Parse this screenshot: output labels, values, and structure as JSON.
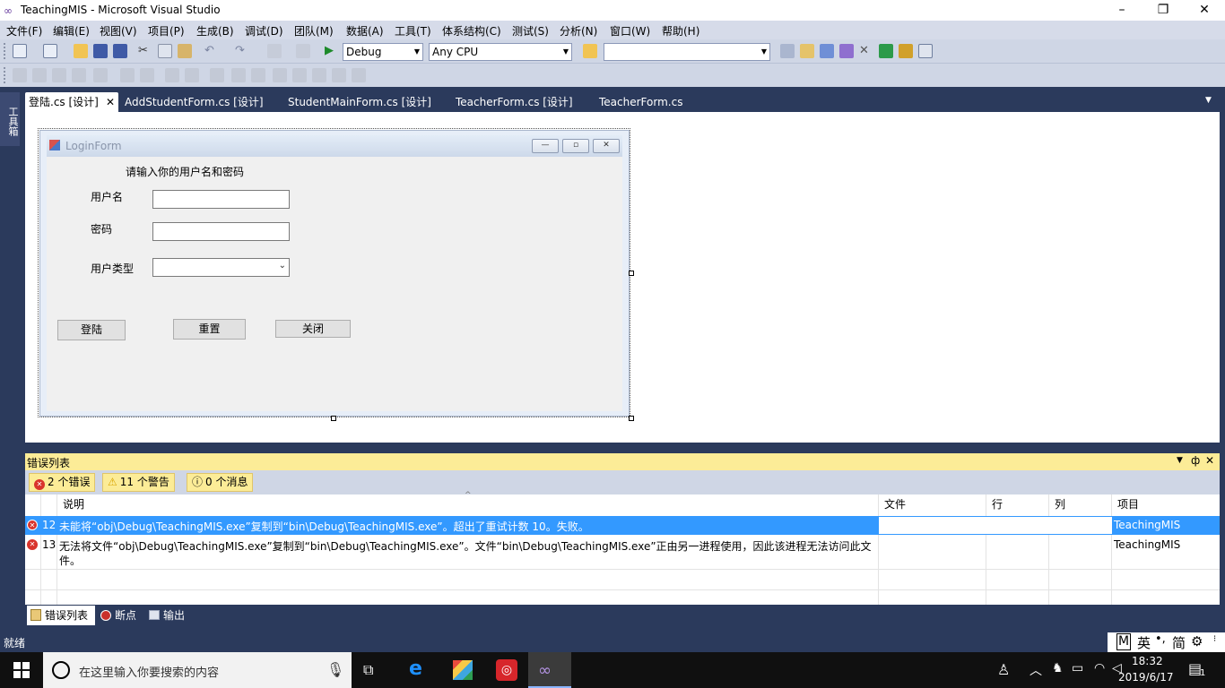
{
  "window": {
    "title": "TeachingMIS - Microsoft Visual Studio",
    "controls": [
      "–",
      "❐",
      "✕"
    ]
  },
  "menu": [
    "文件(F)",
    "编辑(E)",
    "视图(V)",
    "项目(P)",
    "生成(B)",
    "调试(D)",
    "团队(M)",
    "数据(A)",
    "工具(T)",
    "体系结构(C)",
    "测试(S)",
    "分析(N)",
    "窗口(W)",
    "帮助(H)"
  ],
  "toolbar": {
    "config": "Debug",
    "platform": "Any CPU",
    "find_value": ""
  },
  "toolbox_strip": {
    "label": "工具箱"
  },
  "doc_tabs": [
    {
      "label": "登陆.cs [设计]",
      "active": true
    },
    {
      "label": "AddStudentForm.cs [设计]"
    },
    {
      "label": "StudentMainForm.cs [设计]"
    },
    {
      "label": "TeacherForm.cs [设计]"
    },
    {
      "label": "TeacherForm.cs"
    }
  ],
  "login_form": {
    "title": "LoginForm",
    "prompt": "请输入你的用户名和密码",
    "username_label": "用户名",
    "username_value": "",
    "password_label": "密码",
    "password_value": "",
    "usertype_label": "用户类型",
    "usertype_value": "",
    "login_button": "登陆",
    "reset_button": "重置",
    "close_button": "关闭"
  },
  "error_list": {
    "title": "错误列表",
    "filters": {
      "errors": "2 个错误",
      "warnings": "11 个警告",
      "messages": "0 个消息"
    },
    "columns": [
      "说明",
      "文件",
      "行",
      "列",
      "项目"
    ],
    "rows": [
      {
        "num": "12",
        "description": "未能将“obj\\Debug\\TeachingMIS.exe”复制到“bin\\Debug\\TeachingMIS.exe”。超出了重试计数 10。失败。",
        "file": "",
        "line": "",
        "column": "",
        "project": "TeachingMIS",
        "selected": true
      },
      {
        "num": "13",
        "description": "无法将文件“obj\\Debug\\TeachingMIS.exe”复制到“bin\\Debug\\TeachingMIS.exe”。文件“bin\\Debug\\TeachingMIS.exe”正由另一进程使用，因此该进程无法访问此文",
        "description_wrap": "件。",
        "file": "",
        "line": "",
        "column": "",
        "project": "TeachingMIS"
      }
    ]
  },
  "bottom_tabs": [
    {
      "label": "错误列表",
      "active": true
    },
    {
      "label": "断点"
    },
    {
      "label": "输出"
    }
  ],
  "status": {
    "text": "就绪"
  },
  "ime": {
    "mode": "M",
    "lang": "英",
    "punct": "•,",
    "script": "简"
  },
  "taskbar": {
    "search_placeholder": "在这里输入你要搜索的内容",
    "time": "18:32",
    "date": "2019/6/17",
    "notification_count": "1"
  },
  "colors": {
    "vs_dark": "#2b3a5c",
    "selection": "#3399ff",
    "error_header": "#fcec97",
    "error_icon": "#d9342c"
  }
}
